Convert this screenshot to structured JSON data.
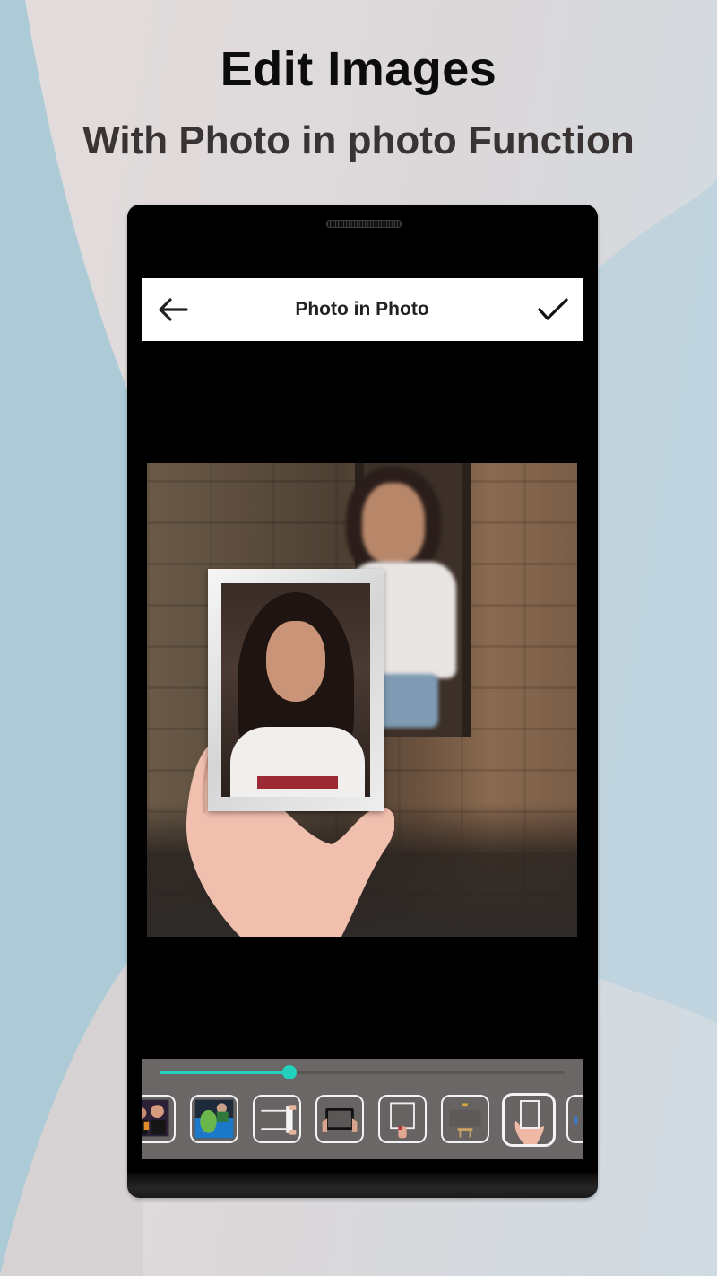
{
  "promo": {
    "headline": "Edit Images",
    "subheadline": "With Photo in photo Function"
  },
  "colors": {
    "accent": "#22d2be",
    "appbar_bg": "#ffffff",
    "tool_panel_bg": "#6b6766",
    "background_blue": "#aecbd6"
  },
  "appbar": {
    "title": "Photo in Photo",
    "back_icon": "arrow-left-icon",
    "done_icon": "checkmark-icon"
  },
  "editor": {
    "canvas_description": "Blurred photo of woman in window with framed sharp photo held by hand",
    "slider": {
      "label": "frame-size",
      "value_percent": 32
    },
    "frames": [
      {
        "id": "frame-party",
        "label": "party-collage",
        "selected": false,
        "partial": true
      },
      {
        "id": "frame-glass-water",
        "label": "glass-in-water",
        "selected": false
      },
      {
        "id": "frame-hanging-scroll",
        "label": "hanging-scroll",
        "selected": false
      },
      {
        "id": "frame-tablet-hands",
        "label": "tablet-in-hands",
        "selected": false
      },
      {
        "id": "frame-hand-holding",
        "label": "hand-holding-frame",
        "selected": false
      },
      {
        "id": "frame-easel",
        "label": "easel-canvas",
        "selected": false
      },
      {
        "id": "frame-palm-holding",
        "label": "palm-holding-frame",
        "selected": true
      },
      {
        "id": "frame-more",
        "label": "more-frame",
        "selected": false,
        "partial": true
      }
    ]
  }
}
